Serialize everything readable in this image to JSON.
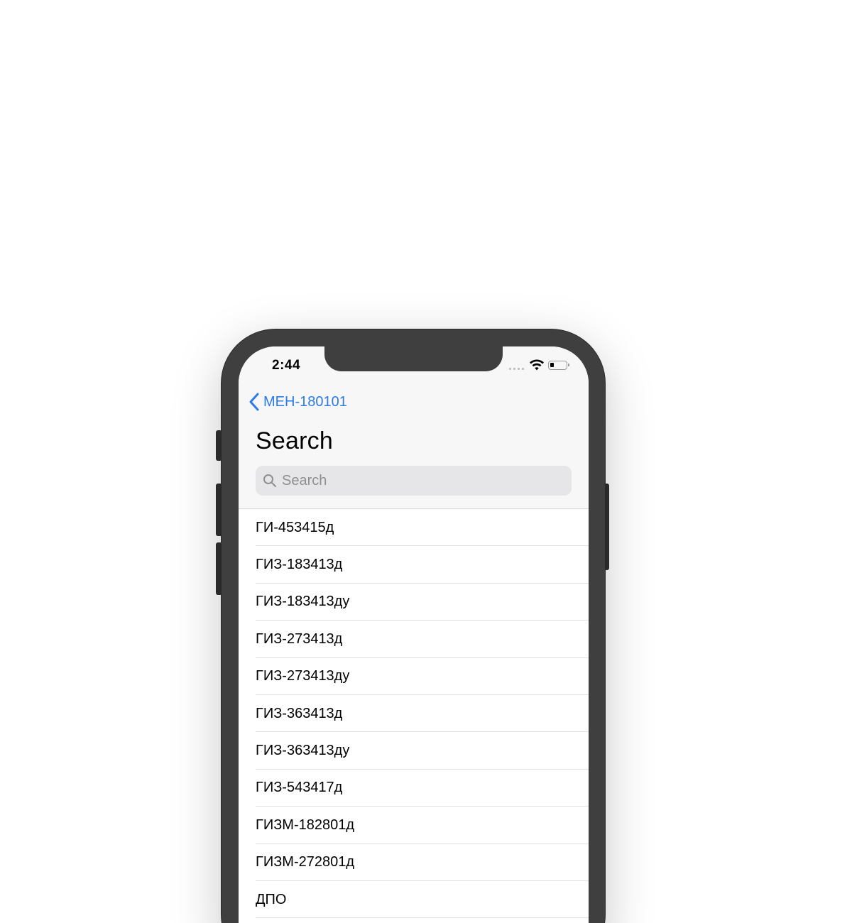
{
  "status_bar": {
    "time": "2:44",
    "icons": [
      "cellular-signal-icon",
      "wifi-icon",
      "battery-icon"
    ]
  },
  "nav": {
    "back_label": "МЕН-180101",
    "title": "Search"
  },
  "search": {
    "placeholder": "Search",
    "value": ""
  },
  "list": {
    "items": [
      "ГИ-453415д",
      "ГИЗ-183413д",
      "ГИЗ-183413ду",
      "ГИЗ-273413д",
      "ГИЗ-273413ду",
      "ГИЗ-363413д",
      "ГИЗ-363413ду",
      "ГИЗ-543417д",
      "ГИЗМ-182801д",
      "ГИЗМ-272801д",
      "ДПО"
    ]
  },
  "colors": {
    "accent": "#2b7be8",
    "phone_frame": "#3f3f3f",
    "header_bg": "#f7f7f7",
    "search_bg": "#e6e6e8",
    "placeholder": "#8e8e93"
  }
}
